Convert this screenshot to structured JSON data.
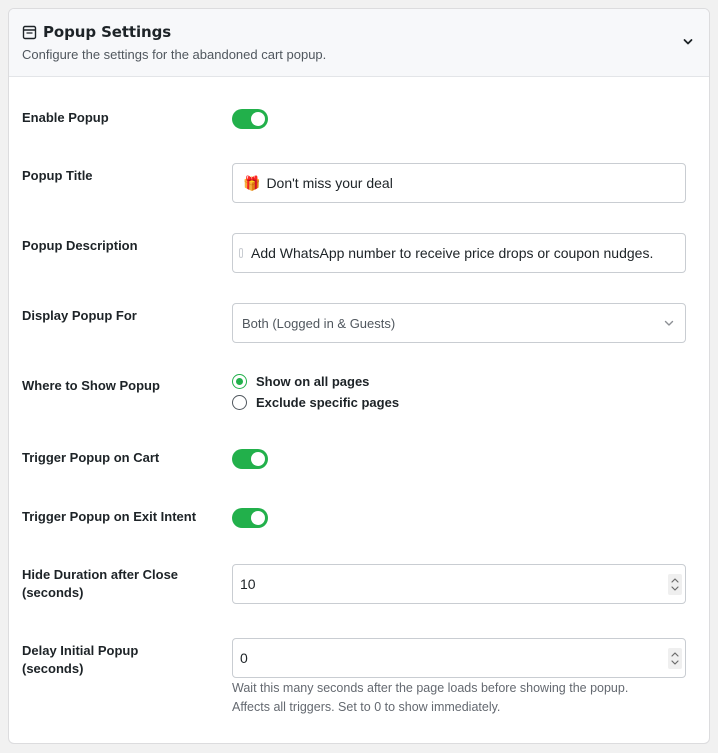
{
  "header": {
    "title": "Popup Settings",
    "subtitle": "Configure the settings for the abandoned cart popup.",
    "icon": "window-icon",
    "toggle_icon": "chevron-down-icon"
  },
  "colors": {
    "accent": "#22b04b",
    "toggle_knob": "#ffffff",
    "label": "#1d2327",
    "muted": "#646970"
  },
  "fields": {
    "enable_popup": {
      "label": "Enable Popup",
      "on": true
    },
    "popup_title": {
      "label": "Popup Title",
      "emoji": "🎁",
      "value": "Don't miss your deal"
    },
    "popup_description": {
      "label": "Popup Description",
      "value": "Add WhatsApp number to receive price drops or coupon nudges."
    },
    "display_for": {
      "label": "Display Popup For",
      "selected": "Both (Logged in & Guests)"
    },
    "where_to_show": {
      "label": "Where to Show Popup",
      "options": [
        "Show on all pages",
        "Exclude specific pages"
      ],
      "selected_index": 0
    },
    "trigger_on_cart": {
      "label": "Trigger Popup on Cart",
      "on": true
    },
    "trigger_on_exit": {
      "label": "Trigger Popup on Exit Intent",
      "on": true
    },
    "hide_duration": {
      "label_line1": "Hide Duration after Close",
      "label_line2": "(seconds)",
      "value": "10"
    },
    "delay_initial": {
      "label_line1": "Delay Initial Popup",
      "label_line2": "(seconds)",
      "value": "0",
      "help_line1": "Wait this many seconds after the page loads before showing the popup.",
      "help_line2": "Affects all triggers. Set to 0 to show immediately."
    }
  }
}
